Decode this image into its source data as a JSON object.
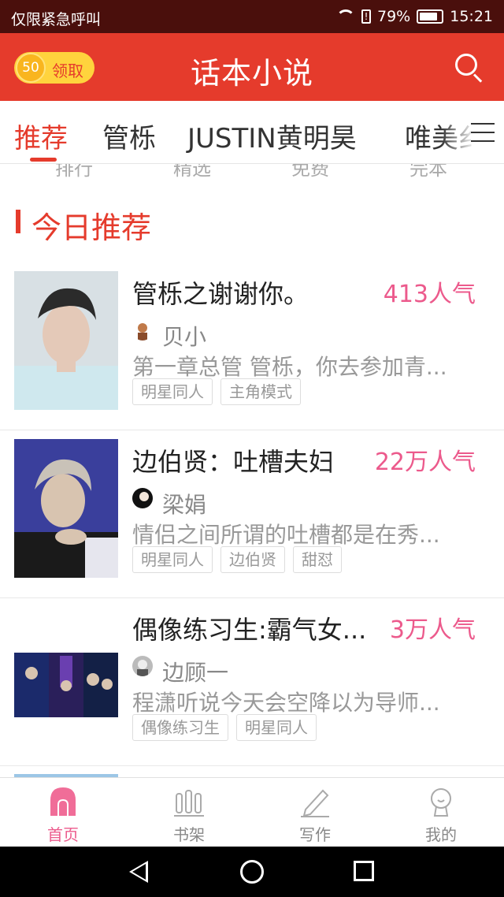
{
  "status_bar": {
    "carrier": "仅限紧急呼叫",
    "battery": "79%",
    "time": "15:21"
  },
  "header": {
    "coins": "50",
    "claim_label": "领取",
    "title": "话本小说",
    "icons": {
      "search": "search-icon",
      "coin": "coin-icon"
    }
  },
  "tabs": [
    "推荐",
    "管栎",
    "JUSTIN黄明昊",
    "唯美纟"
  ],
  "active_tab": "推荐",
  "quick_nav": [
    "排行",
    "精选",
    "免费",
    "完本"
  ],
  "section": {
    "title": "今日推荐"
  },
  "books": [
    {
      "title": "管栎之谢谢你。",
      "popularity": "413人气",
      "author": "贝小",
      "summary": "第一章总管 管栎，你去参加青...",
      "tags": [
        "明星同人",
        "主角模式"
      ],
      "cover_colors": [
        "#cfe8ee",
        "#2b2b2b",
        "#e4c9b8"
      ]
    },
    {
      "title": "边伯贤：吐槽夫妇",
      "popularity": "22万人气",
      "author": "梁娟",
      "summary": "情侣之间所谓的吐槽都是在秀...",
      "tags": [
        "明星同人",
        "边伯贤",
        "甜怼"
      ],
      "cover_colors": [
        "#3a3f9c",
        "#1a1a1a",
        "#d8c4b0"
      ]
    },
    {
      "title": "偶像练习生:霸气女...",
      "popularity": "3万人气",
      "author": "边顾一",
      "summary": "程潇听说今天会空降以为导师...",
      "tags": [
        "偶像练习生",
        "明星同人"
      ],
      "cover_colors": [
        "#1b2a6b",
        "#6a3fb0",
        "#0e1330"
      ]
    }
  ],
  "bottom_nav": [
    {
      "label": "首页",
      "icon": "home-icon",
      "active": true
    },
    {
      "label": "书架",
      "icon": "bookshelf-icon",
      "active": false
    },
    {
      "label": "写作",
      "icon": "pencil-icon",
      "active": false
    },
    {
      "label": "我的",
      "icon": "profile-icon",
      "active": false
    }
  ],
  "colors": {
    "brand": "#e53b2c",
    "pink": "#ec5a8c",
    "coin": "#ffd33d"
  }
}
